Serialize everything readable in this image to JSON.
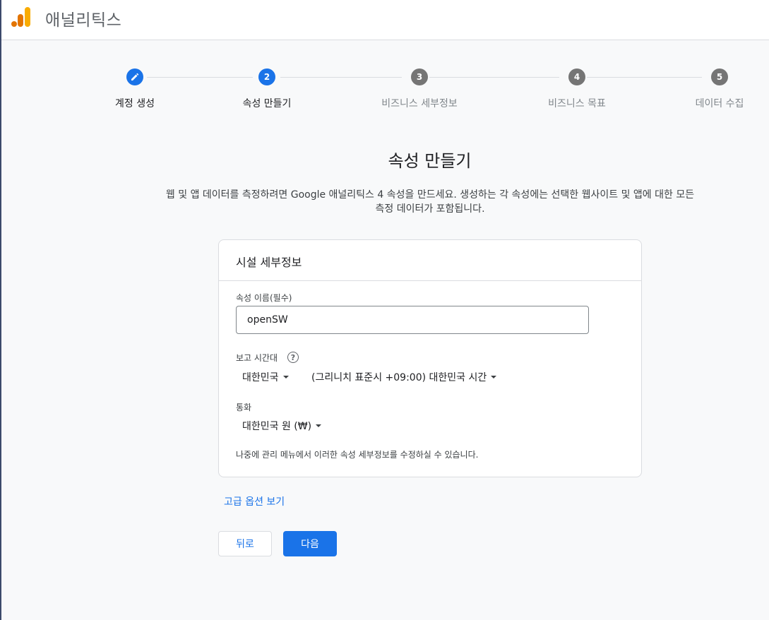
{
  "app": {
    "title": "애널리틱스"
  },
  "stepper": {
    "steps": [
      {
        "number": "",
        "label": "계정 생성",
        "state": "done"
      },
      {
        "number": "2",
        "label": "속성 만들기",
        "state": "current"
      },
      {
        "number": "3",
        "label": "비즈니스 세부정보",
        "state": "todo"
      },
      {
        "number": "4",
        "label": "비즈니스 목표",
        "state": "todo"
      },
      {
        "number": "5",
        "label": "데이터 수집",
        "state": "todo"
      }
    ]
  },
  "page": {
    "title": "속성 만들기",
    "description_line1": "웹 및 앱 데이터를 측정하려면 Google 애널리틱스 4 속성을 만드세요. 생성하는 각 속성에는 선택한 웹사이트 및 앱에 대한 모든",
    "description_line2": "측정 데이터가 포함됩니다."
  },
  "card": {
    "header": "시설 세부정보",
    "property_name_label": "속성 이름(필수)",
    "property_name_value": "openSW",
    "timezone_label": "보고 시간대",
    "help_glyph": "?",
    "country_value": "대한민국",
    "timezone_value": "(그리니치 표준시 +09:00) 대한민국 시간",
    "currency_label": "통화",
    "currency_value": "대한민국 원 (₩)",
    "note": "나중에 관리 메뉴에서 이러한 속성 세부정보를 수정하실 수 있습니다."
  },
  "actions": {
    "advanced_link": "고급 옵션 보기",
    "back_label": "뒤로",
    "next_label": "다음"
  },
  "colors": {
    "accent": "#1a73e8",
    "logo_orange": "#f9ab00",
    "logo_dark_orange": "#e37400",
    "step_inactive": "#757575"
  }
}
